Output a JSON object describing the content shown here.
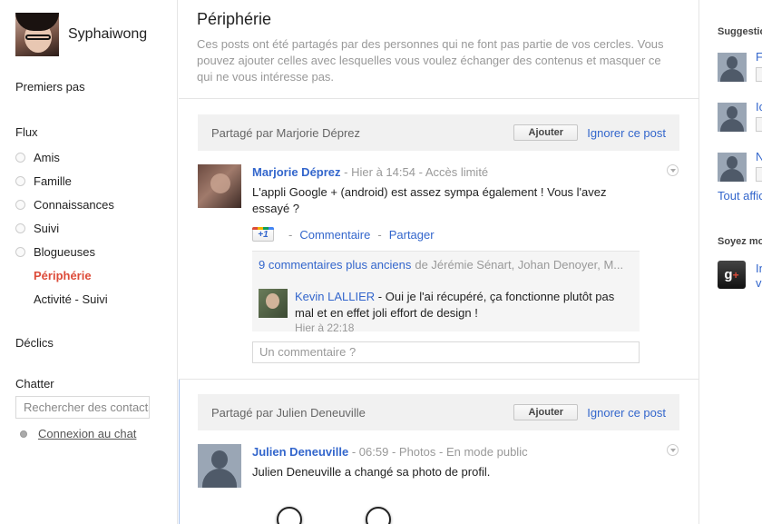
{
  "profile": {
    "name": "Syphaiwong"
  },
  "nav": {
    "premiers_pas": "Premiers pas",
    "flux": "Flux",
    "flux_items": [
      {
        "label": "Amis"
      },
      {
        "label": "Famille"
      },
      {
        "label": "Connaissances"
      },
      {
        "label": "Suivi"
      },
      {
        "label": "Blogueuses"
      },
      {
        "label": "Périphérie"
      },
      {
        "label": "Activité - Suivi"
      }
    ],
    "declics": "Déclics",
    "chatter": "Chatter",
    "search_placeholder": "Rechercher des contacts",
    "chat_connect": "Connexion au chat"
  },
  "main": {
    "title": "Périphérie",
    "description": "Ces posts ont été partagés par des personnes qui ne font pas partie de vos cercles. Vous pouvez ajouter celles avec lesquelles vous voulez échanger des contenus et masquer ce qui ne vous intéresse pas.",
    "add_label": "Ajouter",
    "ignore_label": "Ignorer ce post",
    "posts": [
      {
        "shared_by": "Partagé par Marjorie Déprez",
        "author": "Marjorie Déprez",
        "time": "Hier à 14:54",
        "visibility": "Accès limité",
        "text": "L'appli Google + (android) est assez sympa également ! Vous l'avez essayé ?",
        "plus1": "+1",
        "comment_label": "Commentaire",
        "share_label": "Partager",
        "comments_count": "9 commentaires plus anciens",
        "comments_from": "de Jérémie Sénart, Johan Denoyer, M...",
        "comment": {
          "author": "Kevin LALLIER",
          "text": " - Oui je l'ai récupéré, ça fonctionne plutôt pas mal et en effet joli effort de design !",
          "time": "Hier à 22:18"
        },
        "comment_placeholder": "Un commentaire ?"
      },
      {
        "shared_by": "Partagé par Julien Deneuville",
        "author": "Julien Deneuville",
        "time": "06:59",
        "category": "Photos",
        "visibility": "En mode public",
        "text": "Julien Deneuville a changé sa photo de profil."
      }
    ]
  },
  "right": {
    "suggestions": "Suggestions",
    "people_initials": [
      "F",
      "Ic",
      "N"
    ],
    "tout_afficher": "Tout afficher",
    "soyez": "Soyez mo",
    "g_text": [
      "In",
      "v"
    ]
  }
}
